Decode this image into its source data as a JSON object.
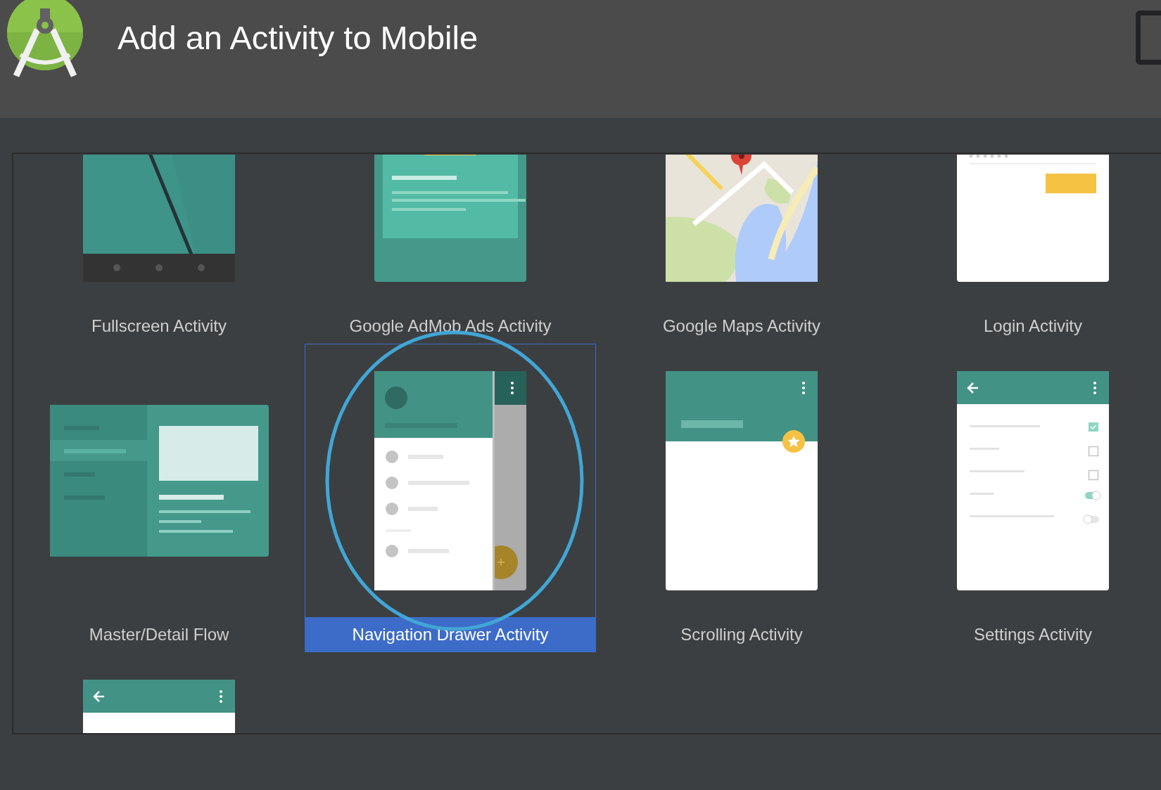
{
  "header": {
    "title": "Add an Activity to Mobile"
  },
  "activities": [
    {
      "label": "Fullscreen Activity",
      "kind": "fullscreen",
      "selected": false
    },
    {
      "label": "Google AdMob Ads Activity",
      "kind": "admob",
      "selected": false
    },
    {
      "label": "Google Maps Activity",
      "kind": "maps",
      "selected": false
    },
    {
      "label": "Login Activity",
      "kind": "login",
      "selected": false
    },
    {
      "label": "Master/Detail Flow",
      "kind": "masterdetail",
      "selected": false
    },
    {
      "label": "Navigation Drawer Activity",
      "kind": "drawer",
      "selected": true
    },
    {
      "label": "Scrolling Activity",
      "kind": "scrolling",
      "selected": false
    },
    {
      "label": "Settings Activity",
      "kind": "settings",
      "selected": false
    },
    {
      "kind": "tabbed",
      "selected": false
    }
  ]
}
